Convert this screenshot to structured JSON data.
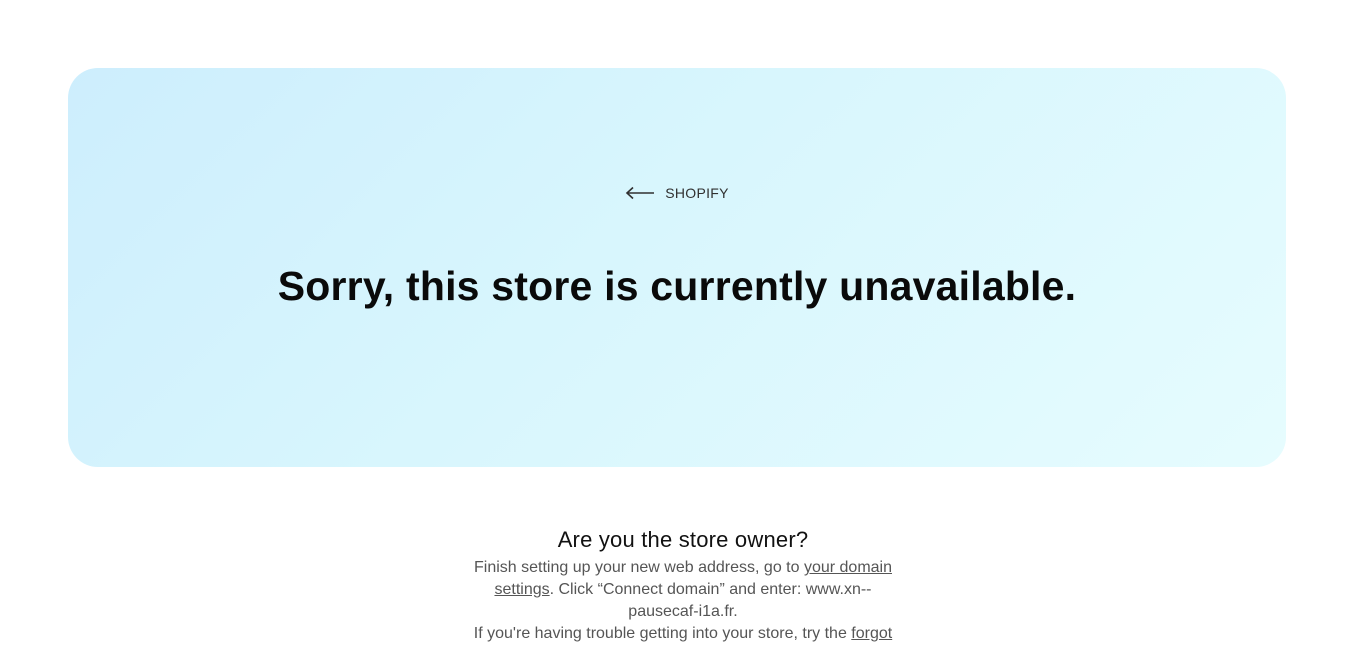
{
  "brand": {
    "label": "SHOPIFY",
    "back_icon": "left-arrow-icon"
  },
  "hero": {
    "headline": "Sorry, this store is currently unavailable."
  },
  "owner": {
    "heading": "Are you the store owner?",
    "p1_prefix": "Finish setting up your new web address, go to ",
    "p1_link": "your domain settings",
    "p1_suffix": ". Click “Connect domain” and enter: www.xn--pausecaf-i1a.fr.",
    "p2_prefix": "If you're having trouble getting into your store, try the ",
    "p2_link": "forgot"
  },
  "colors": {
    "hero_start": "#cdeefd",
    "hero_end": "#e6fcfe",
    "text_muted": "#555555"
  }
}
